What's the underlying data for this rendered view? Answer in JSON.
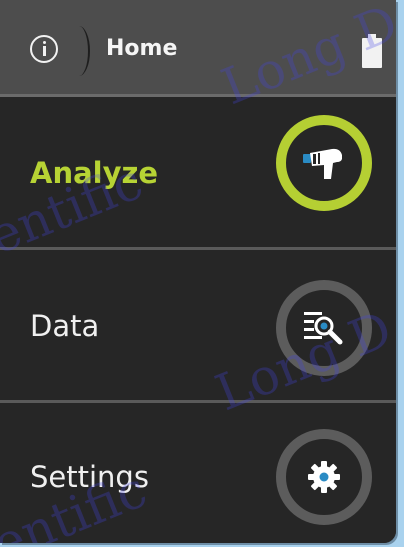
{
  "header": {
    "title": "Home",
    "info_icon": "info-icon",
    "battery_icon": "battery-icon"
  },
  "menu": [
    {
      "label": "Analyze",
      "icon": "analyzer-gun-icon",
      "active": true
    },
    {
      "label": "Data",
      "icon": "data-search-icon",
      "active": false
    },
    {
      "label": "Settings",
      "icon": "gear-icon",
      "active": false
    }
  ],
  "watermark": {
    "text_1": "Long D",
    "text_2": "entific",
    "text_3": "Long D",
    "text_4": "entific"
  },
  "colors": {
    "accent": "#b5cf33",
    "header_bg": "#4d4d4d",
    "panel_bg": "#262626",
    "ring_inactive": "#5c5c5c"
  }
}
